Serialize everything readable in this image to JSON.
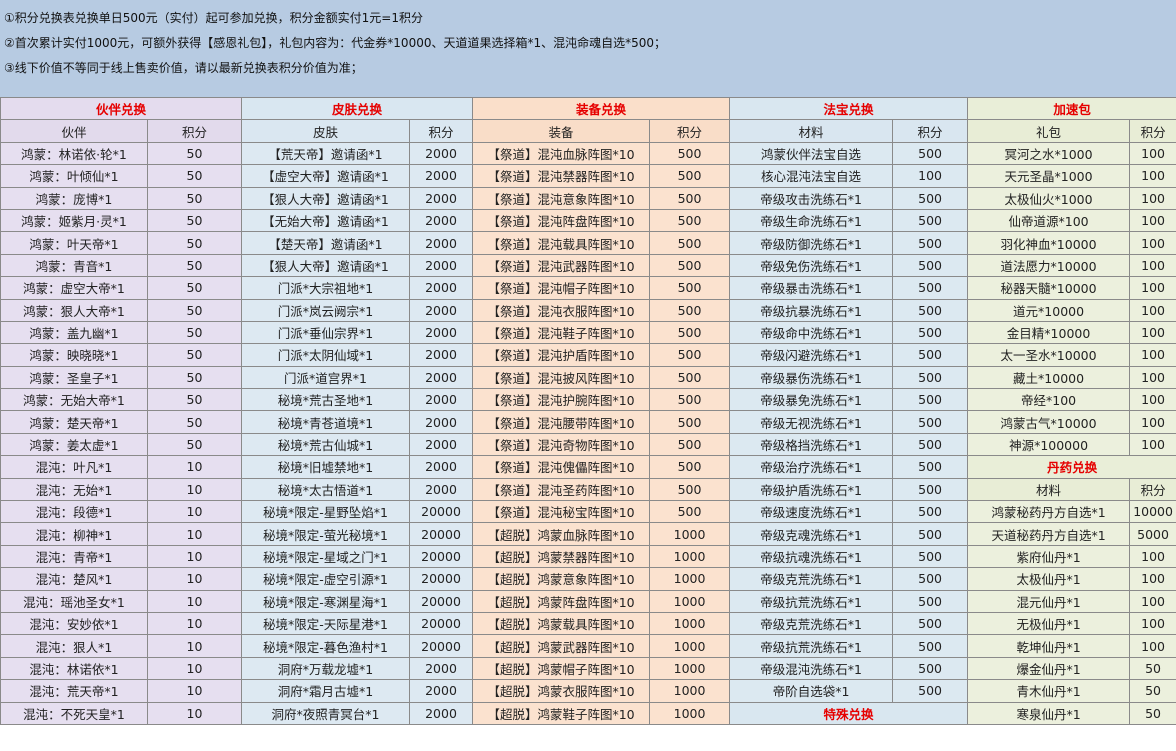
{
  "notes": [
    "①积分兑换表兑换单日500元（实付）起可参加兑换，积分金额实付1元=1积分",
    "②首次累计实付1000元，可额外获得【感恩礼包】，礼包内容为：代金券*10000、天道道果选择箱*1、混沌命魂自选*500；",
    "③线下价值不等同于线上售卖价值，请以最新兑换表积分价值为准；"
  ],
  "sections": [
    "伙伴兑换",
    "皮肤兑换",
    "装备兑换",
    "法宝兑换",
    "加速包"
  ],
  "headers": [
    "伙伴",
    "积分",
    "皮肤",
    "积分",
    "装备",
    "积分",
    "材料",
    "积分",
    "礼包",
    "积分"
  ],
  "rows": [
    [
      "鸿蒙：林诺依·轮*1",
      "50",
      "【荒天帝】邀请函*1",
      "2000",
      "【祭道】混沌血脉阵图*10",
      "500",
      "鸿蒙伙伴法宝自选",
      "500",
      "冥河之水*1000",
      "100"
    ],
    [
      "鸿蒙：叶倾仙*1",
      "50",
      "【虚空大帝】邀请函*1",
      "2000",
      "【祭道】混沌禁器阵图*10",
      "500",
      "核心混沌法宝自选",
      "100",
      "天元圣晶*1000",
      "100"
    ],
    [
      "鸿蒙：庞博*1",
      "50",
      "【狠人大帝】邀请函*1",
      "2000",
      "【祭道】混沌意象阵图*10",
      "500",
      "帝级攻击洗练石*1",
      "500",
      "太极仙火*1000",
      "100"
    ],
    [
      "鸿蒙：姬紫月·灵*1",
      "50",
      "【无始大帝】邀请函*1",
      "2000",
      "【祭道】混沌阵盘阵图*10",
      "500",
      "帝级生命洗练石*1",
      "500",
      "仙帝道源*100",
      "100"
    ],
    [
      "鸿蒙：叶天帝*1",
      "50",
      "【楚天帝】邀请函*1",
      "2000",
      "【祭道】混沌载具阵图*10",
      "500",
      "帝级防御洗练石*1",
      "500",
      "羽化神血*10000",
      "100"
    ],
    [
      "鸿蒙：青音*1",
      "50",
      "【狠人大帝】邀请函*1",
      "2000",
      "【祭道】混沌武器阵图*10",
      "500",
      "帝级免伤洗练石*1",
      "500",
      "道法愿力*10000",
      "100"
    ],
    [
      "鸿蒙：虚空大帝*1",
      "50",
      "门派*大宗祖地*1",
      "2000",
      "【祭道】混沌帽子阵图*10",
      "500",
      "帝级暴击洗练石*1",
      "500",
      "秘器天髓*10000",
      "100"
    ],
    [
      "鸿蒙：狠人大帝*1",
      "50",
      "门派*岚云阙宗*1",
      "2000",
      "【祭道】混沌衣服阵图*10",
      "500",
      "帝级抗暴洗练石*1",
      "500",
      "道元*10000",
      "100"
    ],
    [
      "鸿蒙：盖九幽*1",
      "50",
      "门派*垂仙宗界*1",
      "2000",
      "【祭道】混沌鞋子阵图*10",
      "500",
      "帝级命中洗练石*1",
      "500",
      "金目精*10000",
      "100"
    ],
    [
      "鸿蒙：映晓晓*1",
      "50",
      "门派*太阴仙域*1",
      "2000",
      "【祭道】混沌护盾阵图*10",
      "500",
      "帝级闪避洗练石*1",
      "500",
      "太一圣水*10000",
      "100"
    ],
    [
      "鸿蒙：圣皇子*1",
      "50",
      "门派*道宫界*1",
      "2000",
      "【祭道】混沌披风阵图*10",
      "500",
      "帝级暴伤洗练石*1",
      "500",
      "藏土*10000",
      "100"
    ],
    [
      "鸿蒙：无始大帝*1",
      "50",
      "秘境*荒古圣地*1",
      "2000",
      "【祭道】混沌护腕阵图*10",
      "500",
      "帝级暴免洗练石*1",
      "500",
      "帝经*100",
      "100"
    ],
    [
      "鸿蒙：楚天帝*1",
      "50",
      "秘境*青苍道境*1",
      "2000",
      "【祭道】混沌腰带阵图*10",
      "500",
      "帝级无视洗练石*1",
      "500",
      "鸿蒙古气*10000",
      "100"
    ],
    [
      "鸿蒙：姜太虚*1",
      "50",
      "秘境*荒古仙城*1",
      "2000",
      "【祭道】混沌奇物阵图*10",
      "500",
      "帝级格挡洗练石*1",
      "500",
      "神源*100000",
      "100"
    ],
    [
      "混沌：叶凡*1",
      "10",
      "秘境*旧墟禁地*1",
      "2000",
      "【祭道】混沌傀儡阵图*10",
      "500",
      "帝级治疗洗练石*1",
      "500"
    ],
    [
      "混沌：无始*1",
      "10",
      "秘境*太古悟道*1",
      "2000",
      "【祭道】混沌圣药阵图*10",
      "500",
      "帝级护盾洗练石*1",
      "500",
      "材料",
      "积分"
    ],
    [
      "混沌：段德*1",
      "10",
      "秘境*限定-星野坠焰*1",
      "20000",
      "【祭道】混沌秘宝阵图*10",
      "500",
      "帝级速度洗练石*1",
      "500",
      "鸿蒙秘药丹方自选*1",
      "10000"
    ],
    [
      "混沌：柳神*1",
      "10",
      "秘境*限定-萤光秘境*1",
      "20000",
      "【超脱】鸿蒙血脉阵图*10",
      "1000",
      "帝级克魂洗练石*1",
      "500",
      "天道秘药丹方自选*1",
      "5000"
    ],
    [
      "混沌：青帝*1",
      "10",
      "秘境*限定-星域之门*1",
      "20000",
      "【超脱】鸿蒙禁器阵图*10",
      "1000",
      "帝级抗魂洗练石*1",
      "500",
      "紫府仙丹*1",
      "100"
    ],
    [
      "混沌：楚风*1",
      "10",
      "秘境*限定-虚空引源*1",
      "20000",
      "【超脱】鸿蒙意象阵图*10",
      "1000",
      "帝级克荒洗练石*1",
      "500",
      "太极仙丹*1",
      "100"
    ],
    [
      "混沌：瑶池圣女*1",
      "10",
      "秘境*限定-寒渊星海*1",
      "20000",
      "【超脱】鸿蒙阵盘阵图*10",
      "1000",
      "帝级抗荒洗练石*1",
      "500",
      "混元仙丹*1",
      "100"
    ],
    [
      "混沌：安妙依*1",
      "10",
      "秘境*限定-天际星港*1",
      "20000",
      "【超脱】鸿蒙载具阵图*10",
      "1000",
      "帝级克荒洗练石*1",
      "500",
      "无极仙丹*1",
      "100"
    ],
    [
      "混沌：狠人*1",
      "10",
      "秘境*限定-暮色渔村*1",
      "20000",
      "【超脱】鸿蒙武器阵图*10",
      "1000",
      "帝级抗荒洗练石*1",
      "500",
      "乾坤仙丹*1",
      "100"
    ],
    [
      "混沌：林诺依*1",
      "10",
      "洞府*万载龙墟*1",
      "2000",
      "【超脱】鸿蒙帽子阵图*10",
      "1000",
      "帝级混沌洗练石*1",
      "500",
      "爆金仙丹*1",
      "50"
    ],
    [
      "混沌：荒天帝*1",
      "10",
      "洞府*霜月古墟*1",
      "2000",
      "【超脱】鸿蒙衣服阵图*10",
      "1000",
      "帝阶自选袋*1",
      "500",
      "青木仙丹*1",
      "50"
    ],
    [
      "混沌：不死天皇*1",
      "10",
      "洞府*夜照青冥台*1",
      "2000",
      "【超脱】鸿蒙鞋子阵图*10",
      "1000",
      "",
      "",
      "寒泉仙丹*1",
      "50"
    ]
  ],
  "sub_sections": {
    "pill": "丹药兑换",
    "special": "特殊兑换"
  }
}
